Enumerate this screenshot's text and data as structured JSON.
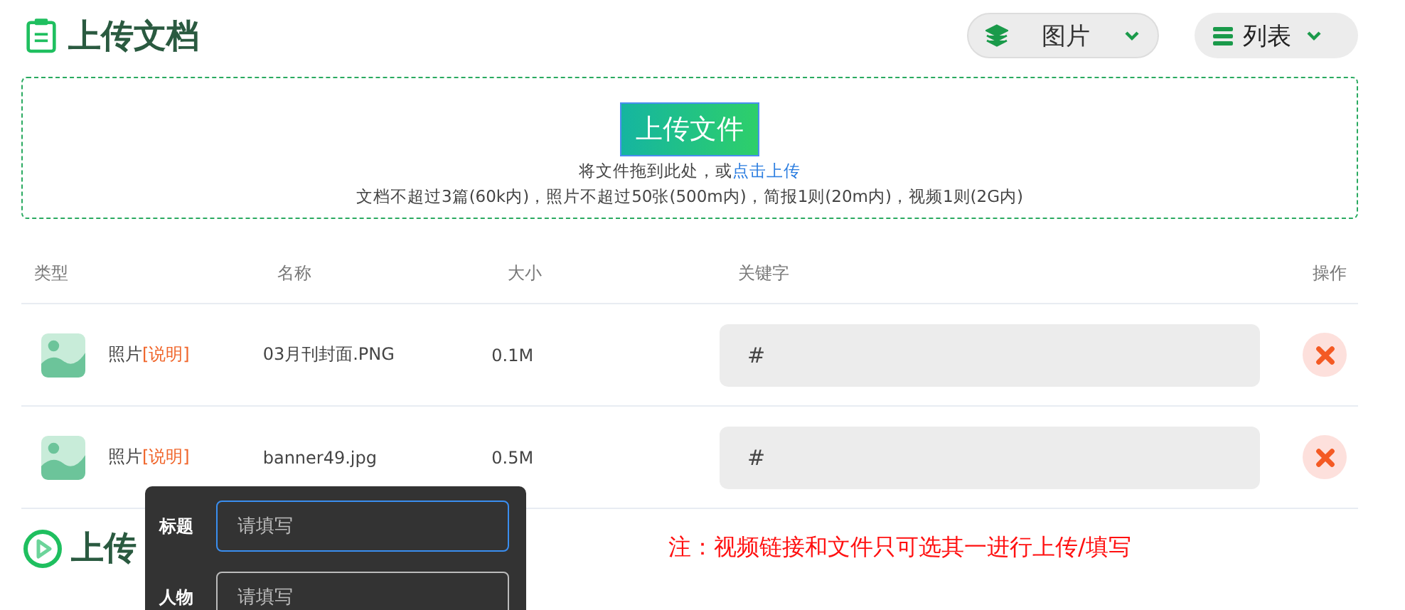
{
  "header": {
    "title": "上传文档",
    "type_select": {
      "value": "图片"
    },
    "view_select": {
      "value": "列表"
    }
  },
  "dropzone": {
    "button": "上传文件",
    "hint": "将文件拖到此处，或",
    "hint_link": "点击上传",
    "limits": "文档不超过3篇(60k内)，照片不超过50张(500m内)，简报1则(20m内)，视频1则(2G内)"
  },
  "table": {
    "columns": [
      "类型",
      "名称",
      "大小",
      "关键字",
      "操作"
    ],
    "rows": [
      {
        "type": "照片",
        "note_link": "[说明]",
        "name": "03月刊封面.PNG",
        "size": "0.1M",
        "keyword": "#"
      },
      {
        "type": "照片",
        "note_link": "[说明]",
        "name": "banner49.jpg",
        "size": "0.5M",
        "keyword": "#"
      }
    ]
  },
  "video_section": {
    "title": "上传",
    "note": "注：视频链接和文件只可选其一进行上传/填写"
  },
  "popover": {
    "fields": [
      {
        "label": "标题",
        "placeholder": "请填写",
        "focused": true
      },
      {
        "label": "人物",
        "placeholder": "请填写",
        "focused": false
      }
    ]
  }
}
